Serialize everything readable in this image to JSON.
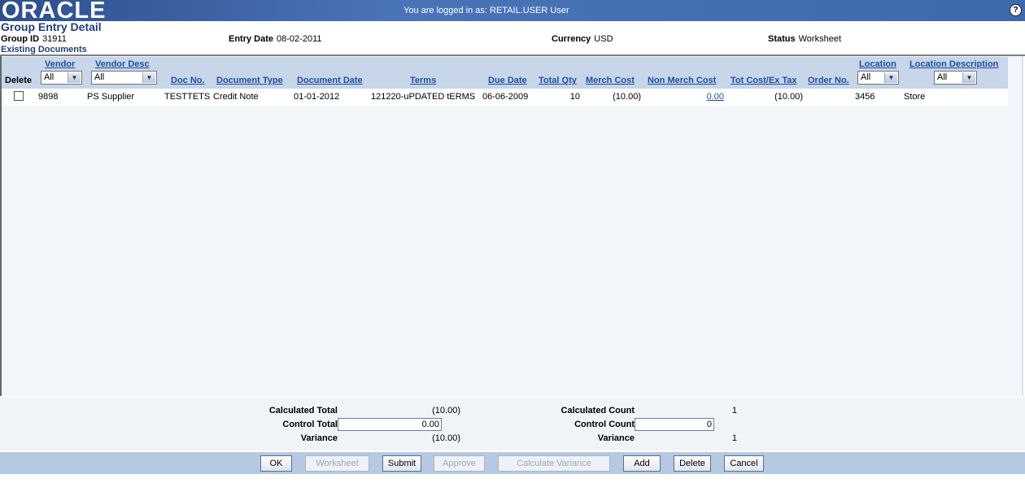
{
  "header": {
    "logo": "ORACLE",
    "trademark": "®",
    "login_text": "You are logged in as: RETAIL.USER User",
    "help": "?"
  },
  "page": {
    "title": "Group Entry Detail",
    "group_id_label": "Group ID",
    "group_id": "31911",
    "entry_date_label": "Entry Date",
    "entry_date": "08-02-2011",
    "currency_label": "Currency",
    "currency": "USD",
    "status_label": "Status",
    "status": "Worksheet",
    "section_title": "Existing Documents"
  },
  "table": {
    "headers": {
      "delete": "Delete",
      "vendor": "Vendor",
      "vendor_desc": "Vendor Desc",
      "doc_no": "Doc No.",
      "document_type": "Document Type",
      "document_date": "Document Date",
      "terms": "Terms",
      "due_date": "Due Date",
      "total_qty": "Total Qty",
      "merch_cost": "Merch Cost",
      "non_merch_cost": "Non Merch Cost",
      "tot_cost": "Tot Cost/Ex Tax",
      "order_no": "Order No.",
      "location": "Location",
      "location_desc": "Location Description"
    },
    "filters": {
      "vendor": "All",
      "vendor_desc": "All",
      "location": "All",
      "location_desc": "All"
    },
    "rows": [
      {
        "vendor": "9898",
        "vendor_desc": "PS Supplier",
        "doc_no": "TESTTETS",
        "document_type": "Credit Note",
        "document_date": "01-01-2012",
        "terms": "121220-uPDATED tERMS",
        "due_date": "06-06-2009",
        "total_qty": "10",
        "merch_cost": "(10.00)",
        "non_merch_cost": "0.00",
        "tot_cost": "(10.00)",
        "order_no": "3456",
        "location_desc": "Store"
      }
    ]
  },
  "totals": {
    "calc_total_label": "Calculated Total",
    "calc_total": "(10.00)",
    "control_total_label": "Control Total",
    "control_total": "0.00",
    "variance_label": "Variance",
    "variance_total": "(10.00)",
    "calc_count_label": "Calculated Count",
    "calc_count": "1",
    "control_count_label": "Control Count",
    "control_count": "0",
    "variance_count_label": "Variance",
    "variance_count": "1"
  },
  "buttons": {
    "ok": "OK",
    "worksheet": "Worksheet",
    "submit": "Submit",
    "approve": "Approve",
    "calculate_variance": "Calculate Variance",
    "add": "Add",
    "delete": "Delete",
    "cancel": "Cancel"
  },
  "icons": {
    "dropdown": "chevron-down-icon",
    "help": "help-icon"
  }
}
